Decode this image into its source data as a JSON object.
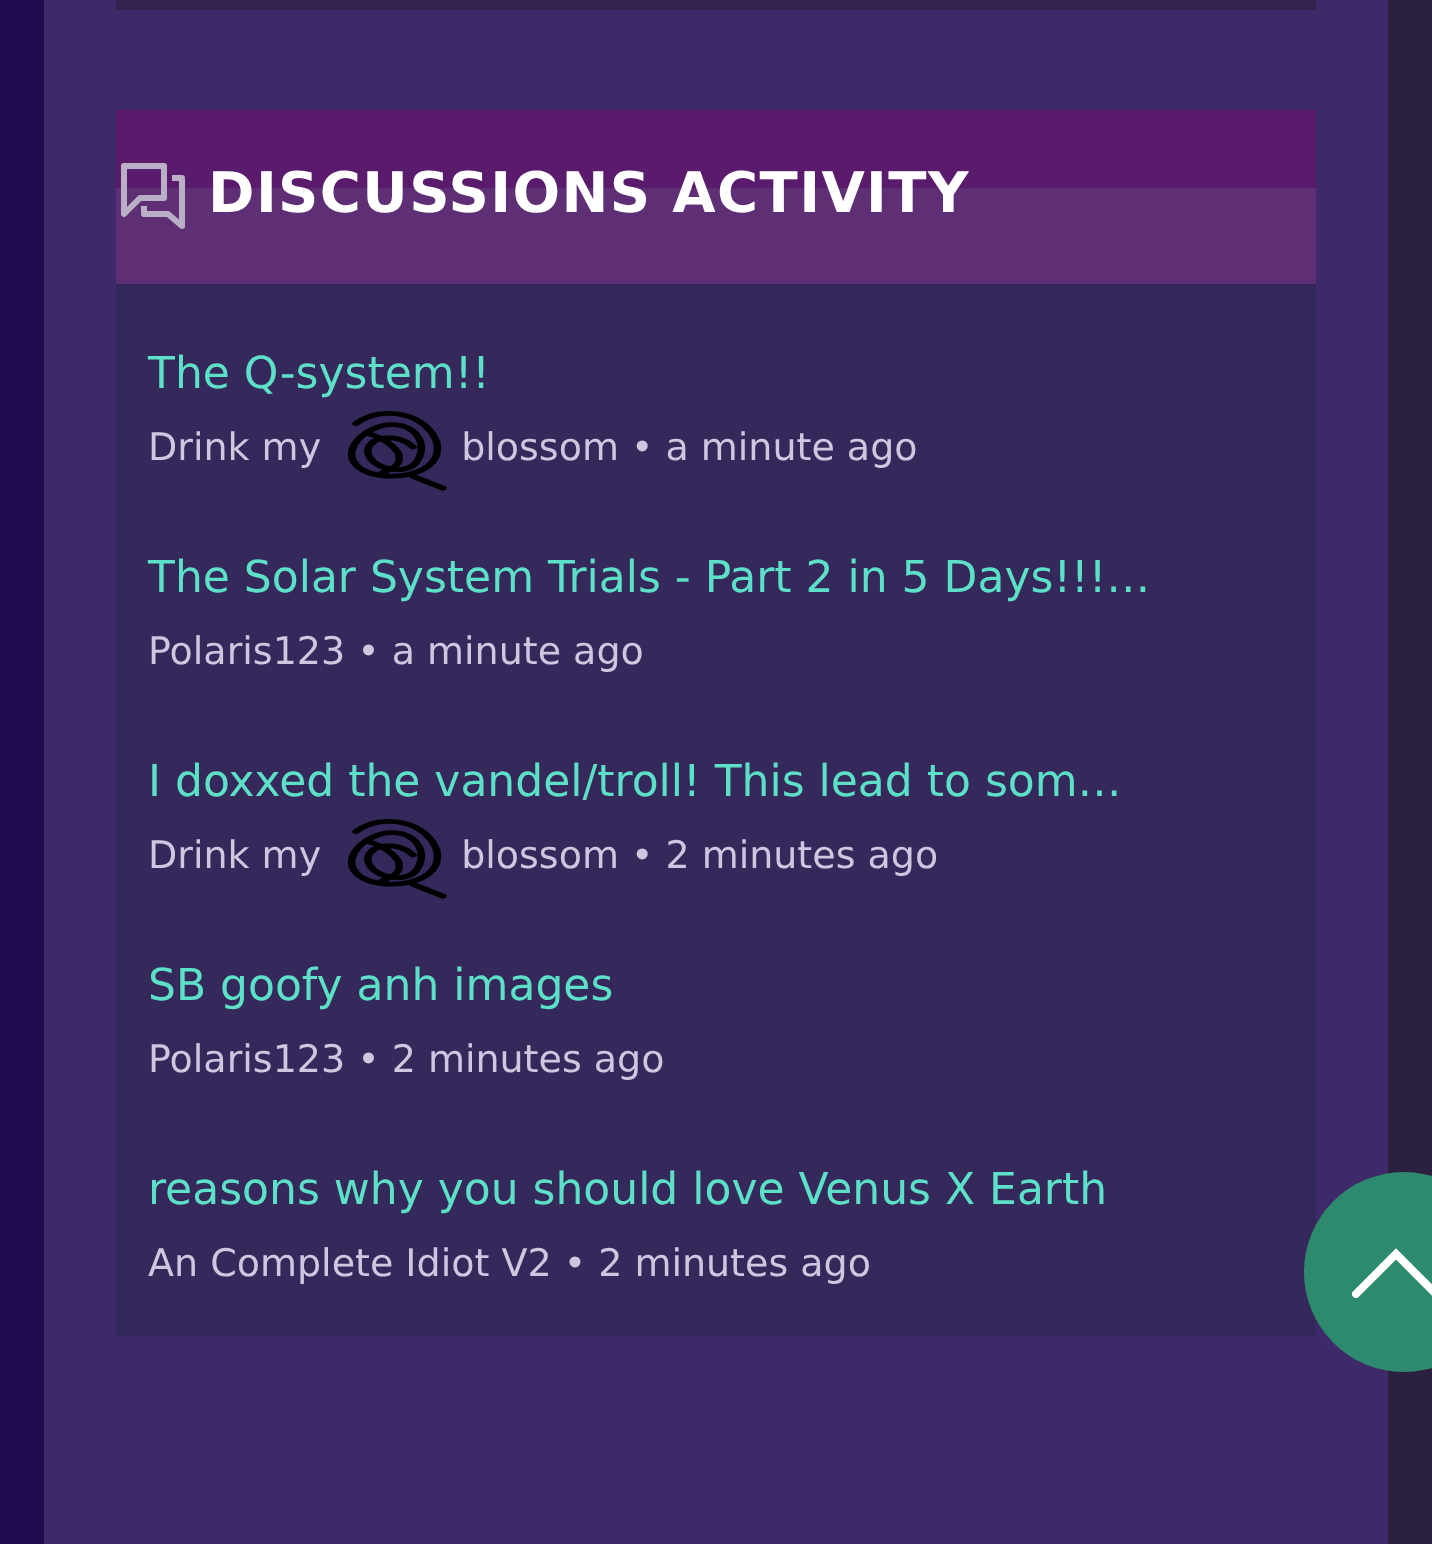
{
  "section": {
    "title": "DISCUSSIONS ACTIVITY"
  },
  "items": [
    {
      "title": "The Q-system!!",
      "author_parts": [
        "Drink my",
        "blossom"
      ],
      "time": "a minute ago",
      "redacted": true
    },
    {
      "title": "The Solar System Trials - Part 2 in 5 Days!!!…",
      "author_parts": [
        "Polaris123"
      ],
      "time": "a minute ago",
      "redacted": false
    },
    {
      "title": "I doxxed the vandel/troll! This lead to som…",
      "author_parts": [
        "Drink my",
        "blossom"
      ],
      "time": "2 minutes ago",
      "redacted": true
    },
    {
      "title": "SB goofy anh images",
      "author_parts": [
        "Polaris123"
      ],
      "time": "2 minutes ago",
      "redacted": false
    },
    {
      "title": "reasons why you should love Venus X Earth",
      "author_parts": [
        "An Complete Idiot V2"
      ],
      "time": "2 minutes ago",
      "redacted": false
    }
  ],
  "separator": "•"
}
